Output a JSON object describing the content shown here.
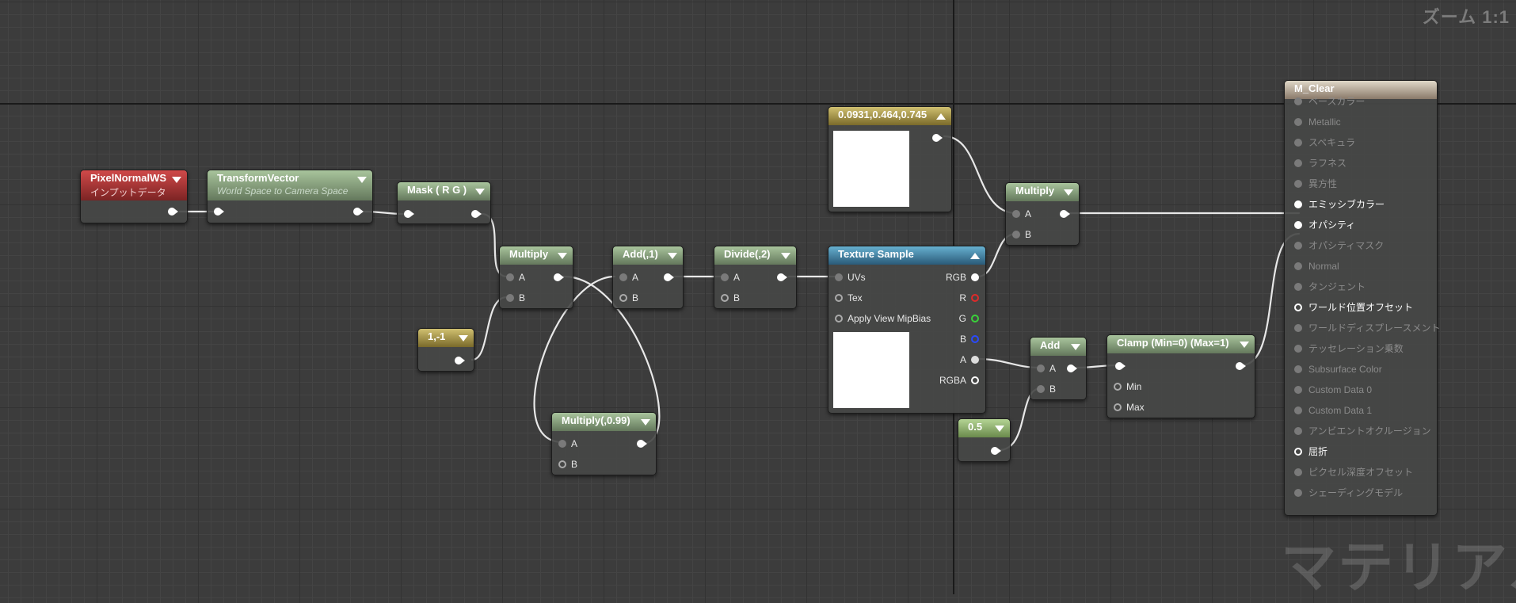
{
  "zoom_label": "ズーム 1:1",
  "watermark": "マテリアル",
  "colors": {
    "white_wire": "#e8e8e8",
    "red_pin": "#e02a2a",
    "green_pin": "#3ad23a",
    "blue_pin": "#2a4aff"
  },
  "nodes": {
    "pixel_normal": {
      "title": "PixelNormalWS",
      "subtitle": "インプットデータ"
    },
    "transform": {
      "title": "TransformVector",
      "subtitle": "World Space to Camera Space"
    },
    "mask": {
      "title": "Mask ( R G )"
    },
    "multiply1": {
      "title": "Multiply",
      "a": "A",
      "b": "B"
    },
    "const_vec": {
      "title": "1,-1"
    },
    "add1": {
      "title": "Add(,1)",
      "a": "A",
      "b": "B"
    },
    "divide": {
      "title": "Divide(,2)",
      "a": "A",
      "b": "B"
    },
    "multiply099": {
      "title": "Multiply(,0.99)",
      "a": "A",
      "b": "B"
    },
    "color_const": {
      "title": "0.0931,0.464,0.745"
    },
    "texture": {
      "title": "Texture Sample",
      "uvs": "UVs",
      "tex": "Tex",
      "mip": "Apply View MipBias",
      "rgb": "RGB",
      "r": "R",
      "g": "G",
      "b": "B",
      "a": "A",
      "rgba": "RGBA"
    },
    "multiply2": {
      "title": "Multiply",
      "a": "A",
      "b": "B"
    },
    "add2": {
      "title": "Add",
      "a": "A",
      "b": "B"
    },
    "half": {
      "title": "0.5"
    },
    "clamp": {
      "title": "Clamp (Min=0) (Max=1)",
      "min": "Min",
      "max": "Max"
    }
  },
  "material": {
    "title": "M_Clear",
    "inputs": [
      {
        "label": "ベースカラー",
        "active": false
      },
      {
        "label": "Metallic",
        "active": false
      },
      {
        "label": "スペキュラ",
        "active": false
      },
      {
        "label": "ラフネス",
        "active": false
      },
      {
        "label": "異方性",
        "active": false
      },
      {
        "label": "エミッシブカラー",
        "active": true
      },
      {
        "label": "オパシティ",
        "active": true
      },
      {
        "label": "オパシティマスク",
        "active": false
      },
      {
        "label": "Normal",
        "active": false
      },
      {
        "label": "タンジェント",
        "active": false
      },
      {
        "label": "ワールド位置オフセット",
        "active": true
      },
      {
        "label": "ワールドディスプレースメント",
        "active": false
      },
      {
        "label": "テッセレーション乗数",
        "active": false
      },
      {
        "label": "Subsurface Color",
        "active": false
      },
      {
        "label": "Custom Data 0",
        "active": false
      },
      {
        "label": "Custom Data 1",
        "active": false
      },
      {
        "label": "アンビエントオクルージョン",
        "active": false
      },
      {
        "label": "屈折",
        "active": true
      },
      {
        "label": "ピクセル深度オフセット",
        "active": false
      },
      {
        "label": "シェーディングモデル",
        "active": false
      }
    ]
  }
}
